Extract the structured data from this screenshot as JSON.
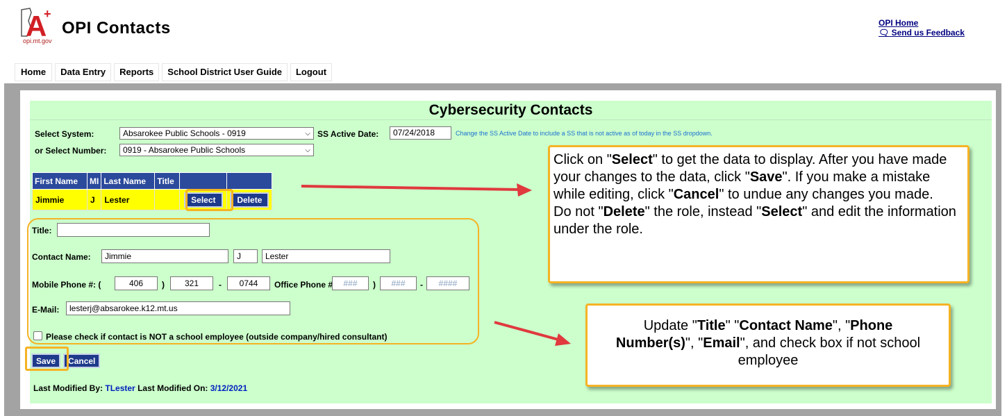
{
  "header": {
    "logo_url_text": "opi.mt.gov",
    "title": "OPI  Contacts",
    "links": {
      "home": "OPI Home",
      "feedback": "Send us Feedback",
      "feedback_icon": "speech-bubble-icon"
    }
  },
  "nav": {
    "items": [
      "Home",
      "Data Entry",
      "Reports",
      "School District User Guide",
      "Logout"
    ]
  },
  "page": {
    "title": "Cybersecurity Contacts"
  },
  "filters": {
    "system_label": "Select System:",
    "system_value": "Absarokee Public Schools - 0919",
    "ss_active_label": "SS Active Date:",
    "ss_active_value": "07/24/2018",
    "ss_note": "Change the SS Active Date to include a SS that is not active as of today in the SS dropdown.",
    "number_label": "or Select Number:",
    "number_value": "0919 - Absarokee Public Schools"
  },
  "table": {
    "headers": [
      "First Name",
      "MI",
      "Last Name",
      "Title",
      "",
      ""
    ],
    "rows": [
      {
        "first": "Jimmie",
        "mi": "J",
        "last": "Lester",
        "title": "",
        "select_label": "Select",
        "delete_label": "Delete"
      }
    ]
  },
  "form": {
    "title_label": "Title:",
    "title_value": "",
    "contact_label": "Contact Name:",
    "first_name": "Jimmie",
    "mi": "J",
    "last_name": "Lester",
    "mobile_label": "Mobile Phone #: (",
    "mobile_area": "406",
    "mobile_prefix": "321",
    "mobile_line": "0744",
    "office_label": "Office Phone #: (",
    "office_area_ph": "###",
    "office_prefix_ph": "###",
    "office_line_ph": "####",
    "paren_close": ")",
    "dash": "-",
    "email_label": "E-Mail:",
    "email_value": "lesterj@absarokee.k12.mt.us",
    "checkbox_label": "Please check if contact is NOT a school employee (outside company/hired consultant)",
    "checkbox_checked": false,
    "save_label": "Save",
    "cancel_label": "Cancel"
  },
  "modified": {
    "by_label": "Last Modified By:",
    "by_value": "TLester",
    "on_label": "Last Modified On:",
    "on_value": "3/12/2021"
  },
  "callouts": {
    "top": {
      "t1": "Click on \"",
      "b1": "Select",
      "t2": "\" to get the data to display. After you have made your changes to the data, click \"",
      "b2": "Save",
      "t3": "\". If you make a mistake while editing, click \"",
      "b3": "Cancel",
      "t4": "\" to undue any changes you made.",
      "t5": "Do not \"",
      "b4": "Delete",
      "t6": "\" the role, instead \"",
      "b5": "Select",
      "t7": "\" and edit the information under the role."
    },
    "bottom": {
      "t1": "Update \"",
      "b1": "Title",
      "t2": "\" \"",
      "b2": "Contact Name",
      "t3": "\", \"",
      "b3": "Phone Number(s)",
      "t4": "\", \"",
      "b4": "Email",
      "t5": "\", and check box if not school employee"
    }
  },
  "colors": {
    "panel": "#ccffcc",
    "table_header": "#2b4a9c",
    "row_highlight": "#ffff00",
    "button": "#1e3a8a",
    "highlight": "#f5b324",
    "arrow": "#e0393e"
  }
}
